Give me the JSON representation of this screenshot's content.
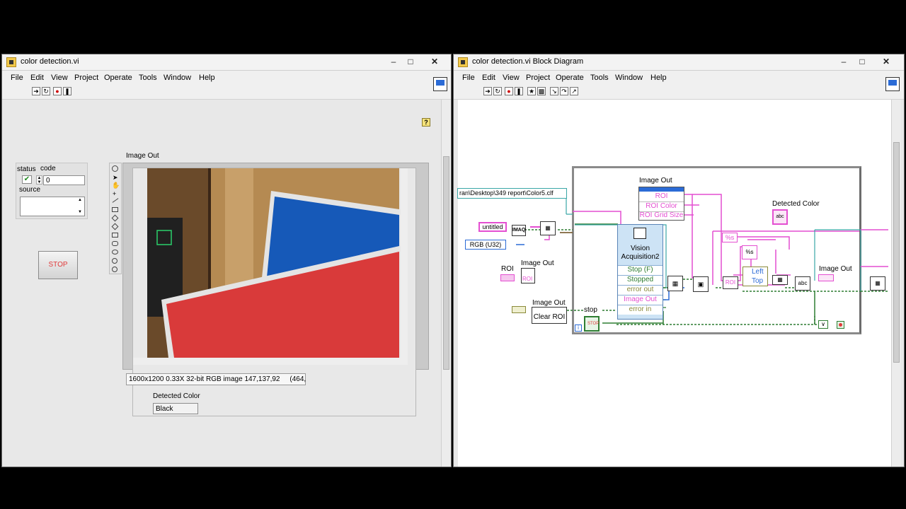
{
  "front_panel": {
    "title": "color detection.vi",
    "menu": [
      "File",
      "Edit",
      "View",
      "Project",
      "Operate",
      "Tools",
      "Window",
      "Help"
    ],
    "status_label": "status",
    "code_label": "code",
    "code_value": "0",
    "source_label": "source",
    "stop_label": "STOP",
    "image_label": "Image Out",
    "image_info": "1600x1200 0.33X 32-bit RGB image 147,137,92     (464,",
    "detected_label": "Detected Color",
    "detected_value": "Black"
  },
  "block_diagram": {
    "title": "color detection.vi Block Diagram",
    "menu": [
      "File",
      "Edit",
      "View",
      "Project",
      "Operate",
      "Tools",
      "Window",
      "Help"
    ],
    "path_const": "ran\\Desktop\\349 report\\Color5.clf",
    "untitled": "untitled",
    "rgb": "RGB (U32)",
    "roi_label": "ROI",
    "image_out_label": "Image Out",
    "roi_tag": "ROI",
    "clear_roi": "Clear ROI",
    "stop_label": "stop",
    "stop_tag": "STOP",
    "property_node": {
      "header": "Image Out",
      "props": [
        "ROI",
        "ROI Color",
        "ROI Grid Size"
      ]
    },
    "vision": {
      "title": "Vision Acquisition2",
      "items": [
        "Stop (F)",
        "Stopped",
        "error out",
        "Image Out",
        "error in"
      ]
    },
    "detected_color_label": "Detected Color",
    "pct_s": "%s",
    "left": "Left",
    "top": "Top",
    "iteration": "i"
  },
  "colors": {
    "stop_red": "#e03a3a",
    "image_blue": "#1659b8",
    "image_red": "#d93a3a",
    "wood": "#b58a52",
    "wire_pink": "#e44fd1",
    "wire_green": "#2e7d32",
    "wire_cyan": "#3aa6a6"
  }
}
